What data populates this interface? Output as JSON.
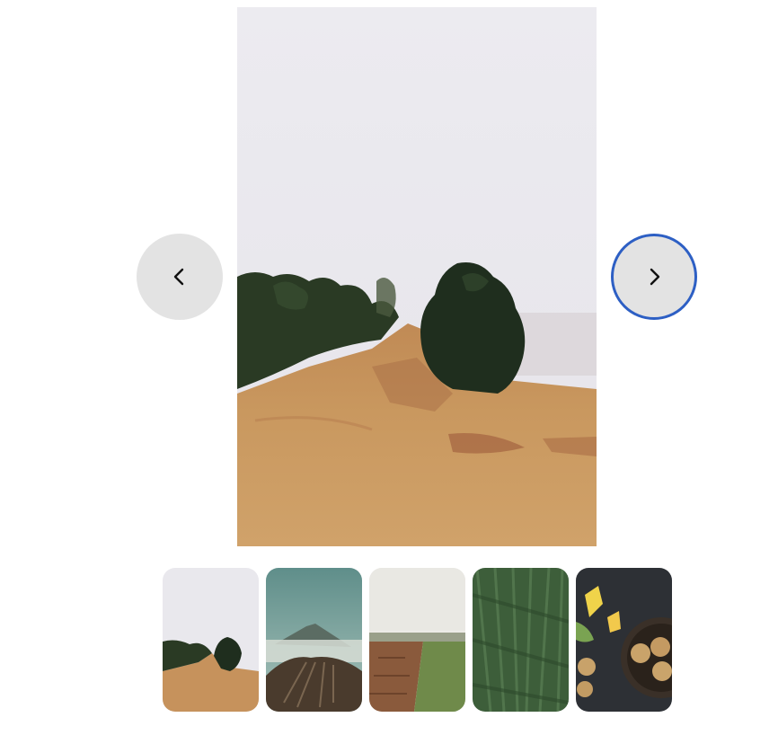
{
  "gallery": {
    "prev_icon": "chevron-left-icon",
    "next_icon": "chevron-right-icon",
    "accent_color": "#2d5fc4",
    "button_color": "#e3e3e3",
    "main_image": {
      "subject": "photo-hill-trees-fog"
    },
    "thumbnails": [
      {
        "subject": "photo-hill-trees-fog",
        "selected": true
      },
      {
        "subject": "photo-volcano-valley"
      },
      {
        "subject": "photo-plowed-field"
      },
      {
        "subject": "photo-grass-closeup"
      },
      {
        "subject": "photo-cookies-flowers"
      }
    ]
  }
}
